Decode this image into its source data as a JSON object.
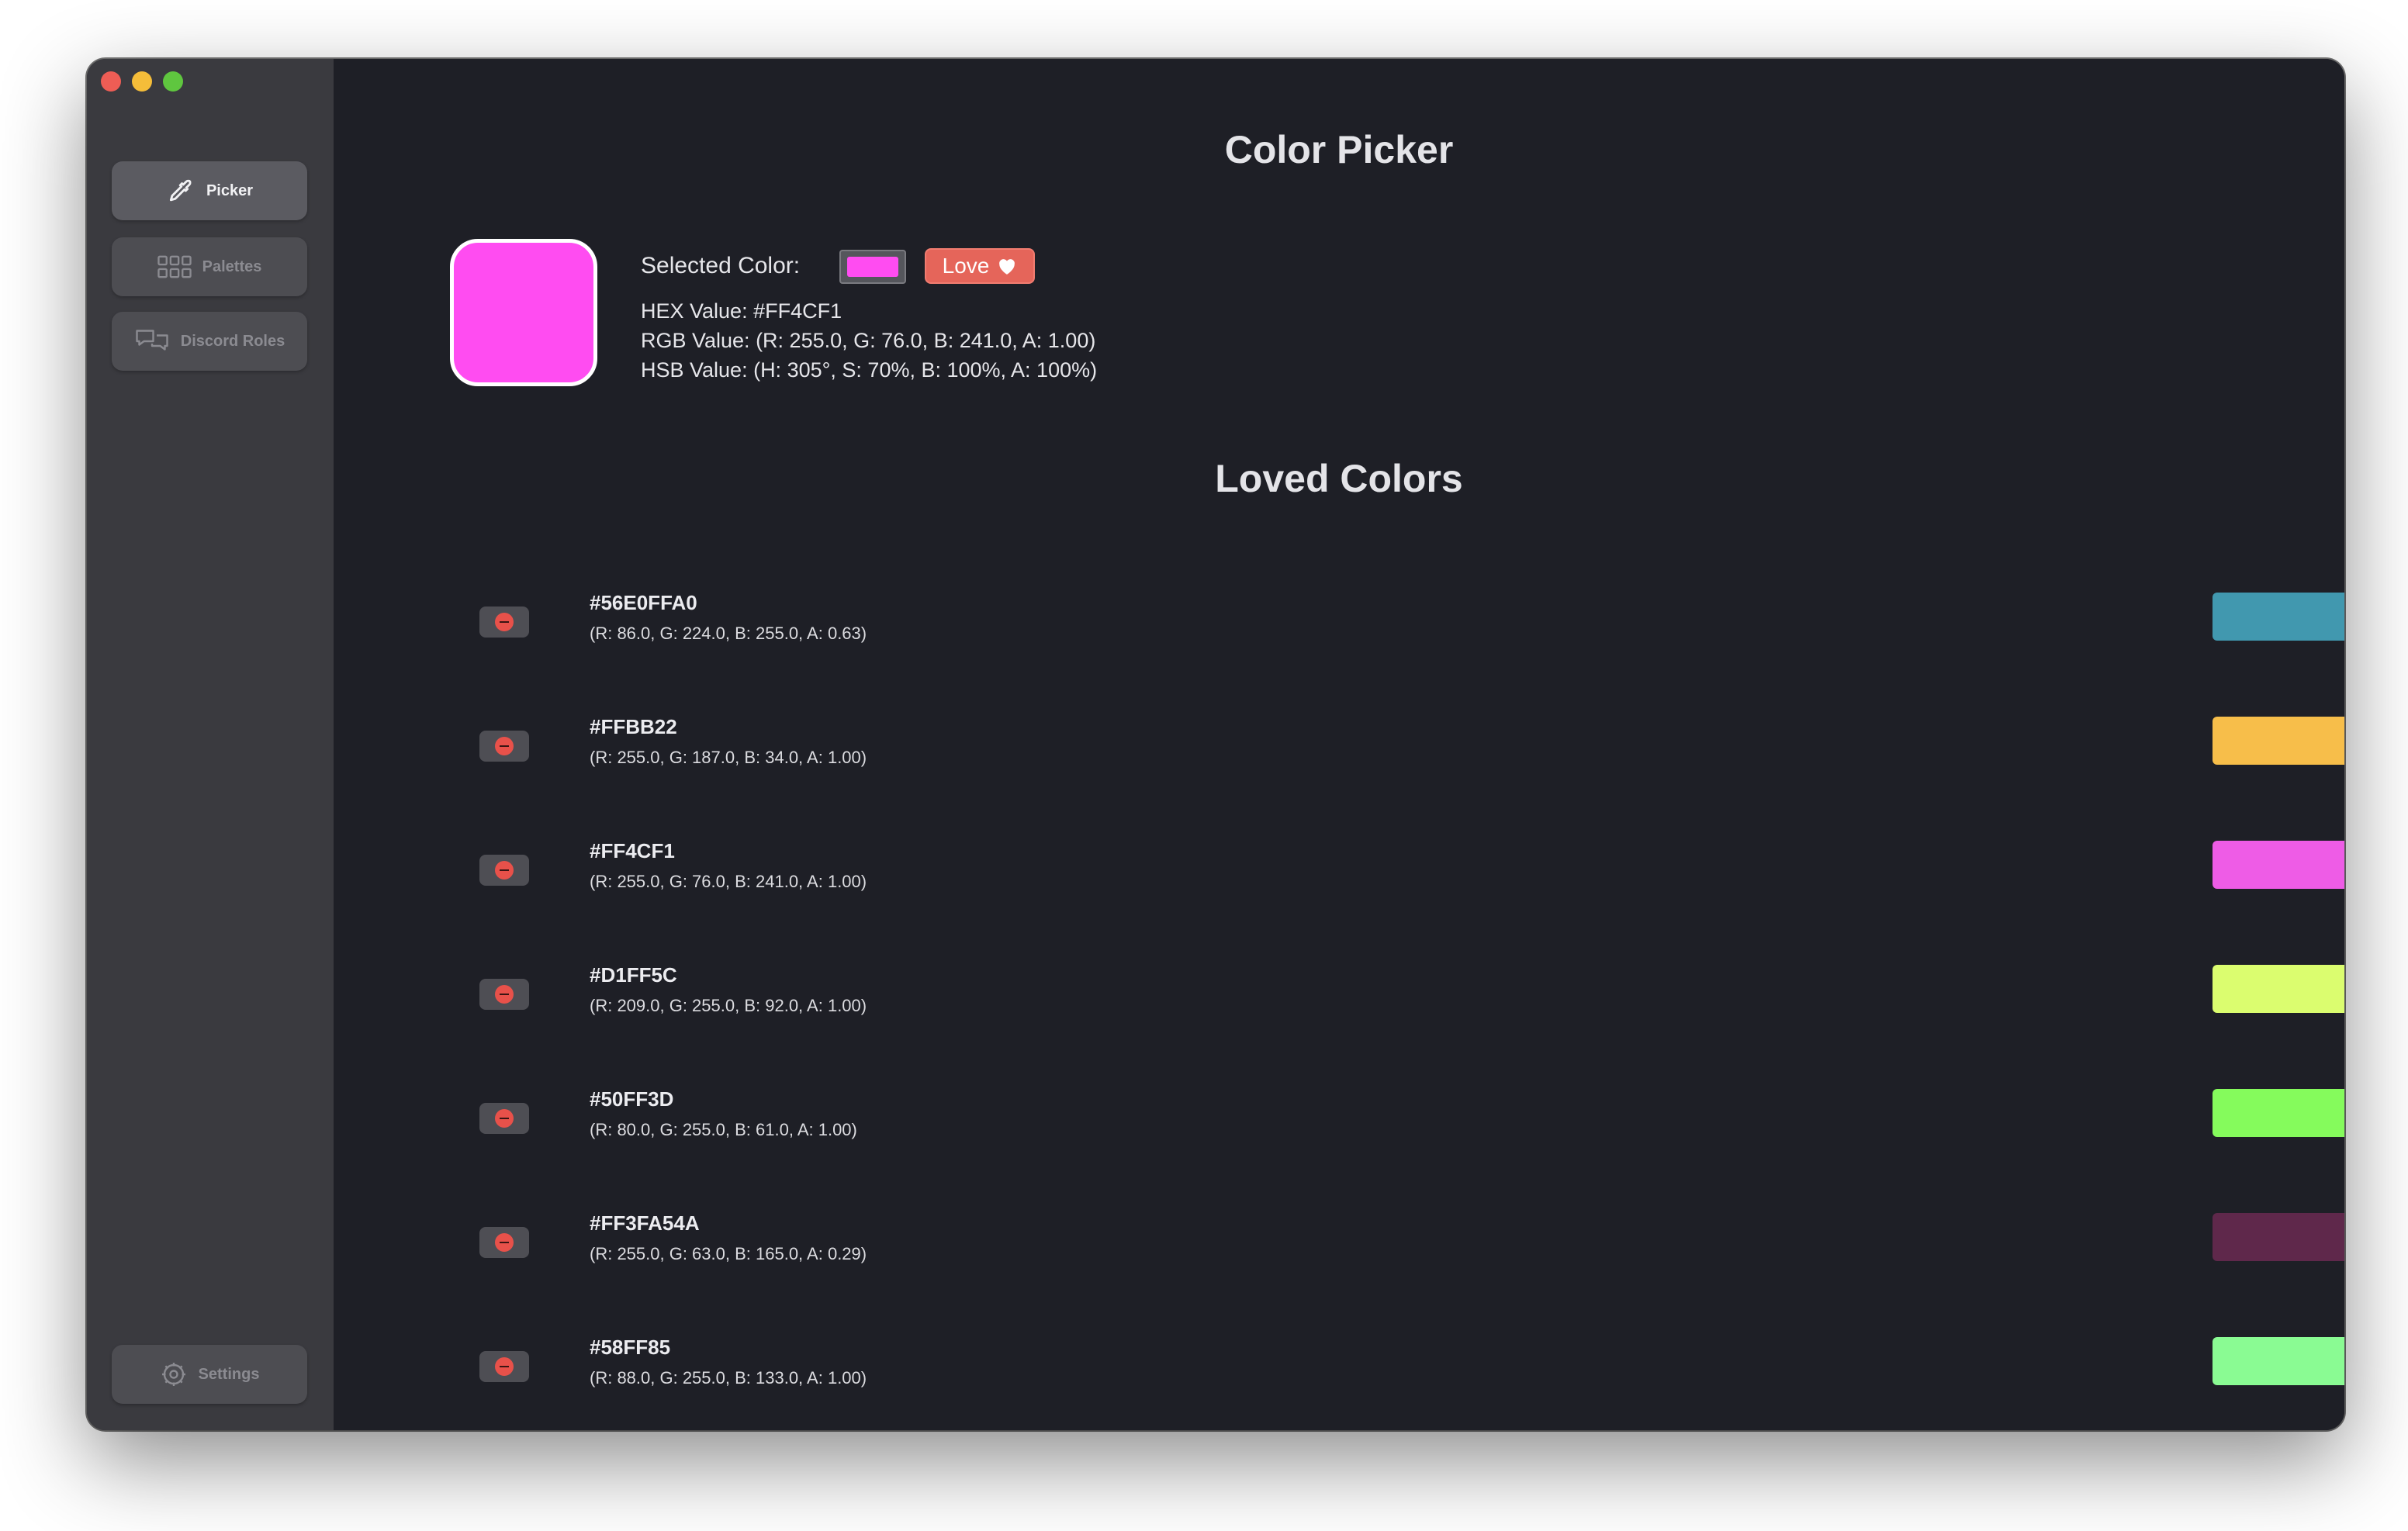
{
  "sidebar": {
    "items": [
      {
        "label": "Picker",
        "icon": "eyedropper-icon",
        "active": true
      },
      {
        "label": "Palettes",
        "icon": "grid-icon",
        "active": false
      },
      {
        "label": "Discord Roles",
        "icon": "chat-bubbles-icon",
        "active": false
      }
    ],
    "settings": {
      "label": "Settings",
      "icon": "gear-icon"
    }
  },
  "header": {
    "title": "Color Picker"
  },
  "selected": {
    "label": "Selected Color:",
    "color": "#FF4CF1",
    "love_label": "Love",
    "hex_line": "HEX Value: #FF4CF1",
    "rgb_line": "RGB Value: (R: 255.0, G: 76.0, B: 241.0, A: 1.00)",
    "hsb_line": "HSB Value: (H: 305°, S: 70%, B: 100%, A: 100%)"
  },
  "loved": {
    "title": "Loved Colors",
    "items": [
      {
        "hex": "#56E0FFA0",
        "rgb": "(R: 86.0, G: 224.0, B: 255.0, A: 0.63)",
        "color": "rgba(86,224,255,0.63)"
      },
      {
        "hex": "#FFBB22",
        "rgb": "(R: 255.0, G: 187.0, B: 34.0, A: 1.00)",
        "color": "#F7BE4A"
      },
      {
        "hex": "#FF4CF1",
        "rgb": "(R: 255.0, G: 76.0, B: 241.0, A: 1.00)",
        "color": "#EE5CE6"
      },
      {
        "hex": "#D1FF5C",
        "rgb": "(R: 209.0, G: 255.0, B: 92.0, A: 1.00)",
        "color": "#DBFD6F"
      },
      {
        "hex": "#50FF3D",
        "rgb": "(R: 80.0, G: 255.0, B: 61.0, A: 1.00)",
        "color": "#85FB5C"
      },
      {
        "hex": "#FF3FA54A",
        "rgb": "(R: 255.0, G: 63.0, B: 165.0, A: 0.29)",
        "color": "rgba(255,63,165,0.29)"
      },
      {
        "hex": "#58FF85",
        "rgb": "(R: 88.0, G: 255.0, B: 133.0, A: 1.00)",
        "color": "#8AFB93"
      }
    ]
  }
}
